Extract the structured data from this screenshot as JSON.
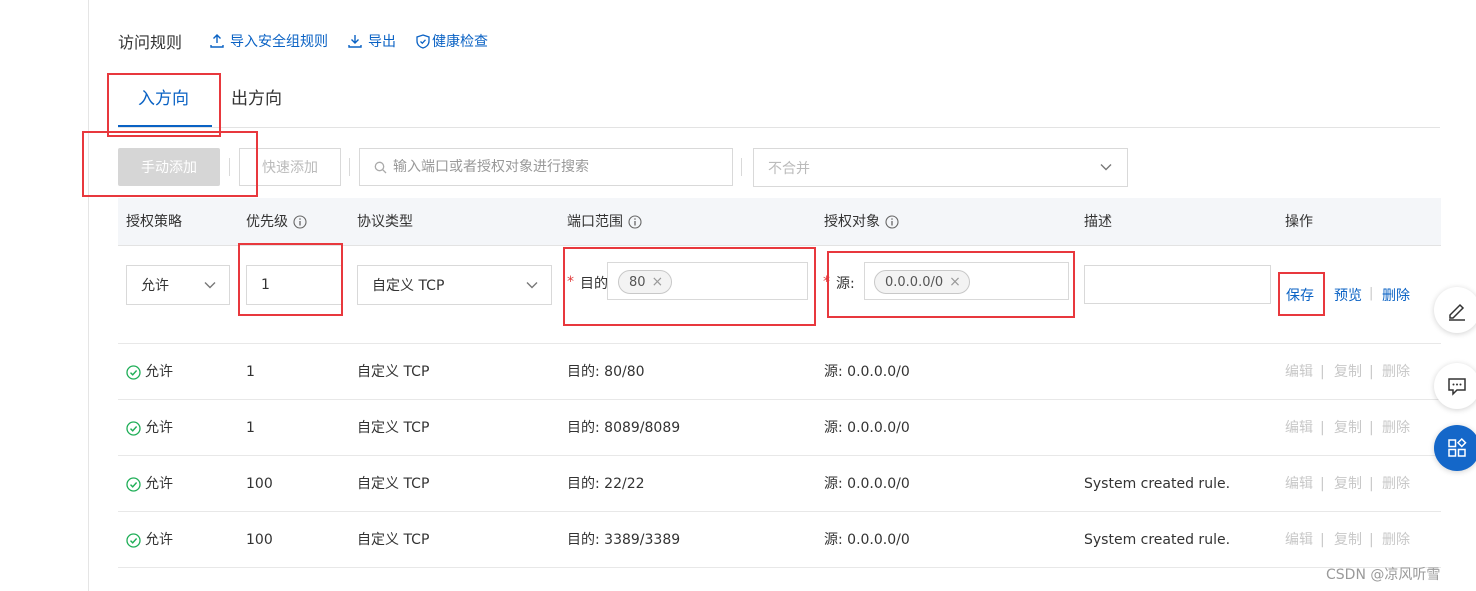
{
  "header": {
    "title": "访问规则",
    "import_label": "导入安全组规则",
    "export_label": "导出",
    "health_label": "健康检查"
  },
  "tabs": [
    {
      "label": "入方向",
      "active": true
    },
    {
      "label": "出方向",
      "active": false
    }
  ],
  "toolbar": {
    "manual_add": "手动添加",
    "quick_add": "快速添加",
    "search_placeholder": "输入端口或者授权对象进行搜索",
    "merge_value": "不合并"
  },
  "table": {
    "columns": {
      "policy": "授权策略",
      "priority": "优先级",
      "protocol": "协议类型",
      "port": "端口范围",
      "auth": "授权对象",
      "desc": "描述",
      "ops": "操作"
    },
    "edit_row": {
      "policy": "允许",
      "priority": "1",
      "protocol": "自定义 TCP",
      "port_label": "目的",
      "port_tag": "80",
      "auth_label": "源:",
      "auth_tag": "0.0.0.0/0",
      "desc": "",
      "save": "保存",
      "preview": "预览",
      "delete": "删除"
    },
    "rows": [
      {
        "policy": "允许",
        "priority": "1",
        "protocol": "自定义 TCP",
        "port": "目的: 80/80",
        "auth": "源: 0.0.0.0/0",
        "desc": ""
      },
      {
        "policy": "允许",
        "priority": "1",
        "protocol": "自定义 TCP",
        "port": "目的: 8089/8089",
        "auth": "源: 0.0.0.0/0",
        "desc": ""
      },
      {
        "policy": "允许",
        "priority": "100",
        "protocol": "自定义 TCP",
        "port": "目的: 22/22",
        "auth": "源: 0.0.0.0/0",
        "desc": "System created rule."
      },
      {
        "policy": "允许",
        "priority": "100",
        "protocol": "自定义 TCP",
        "port": "目的: 3389/3389",
        "auth": "源: 0.0.0.0/0",
        "desc": "System created rule."
      }
    ],
    "row_actions": {
      "edit": "编辑",
      "copy": "复制",
      "delete": "删除"
    }
  },
  "floating": [
    "edit-icon",
    "comment-icon",
    "apps-icon"
  ],
  "watermark": "CSDN @凉风听雪",
  "colors": {
    "accent": "#0a62c4",
    "annotation": "#e8383d",
    "success": "#1fae57"
  }
}
